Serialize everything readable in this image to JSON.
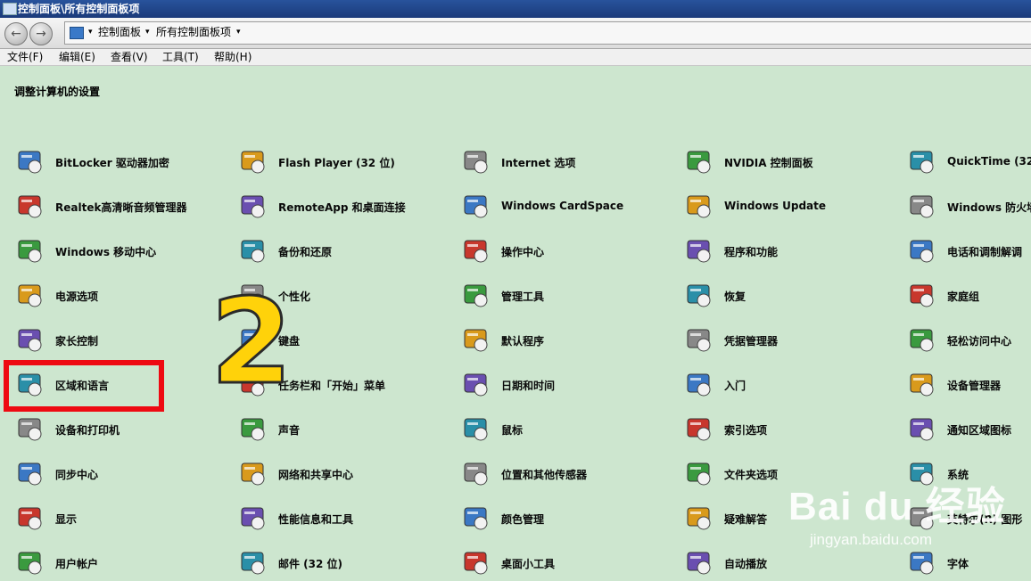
{
  "window": {
    "title": "控制面板\\所有控制面板项"
  },
  "address": {
    "crumbs": [
      "控制面板",
      "所有控制面板项"
    ]
  },
  "menu": [
    "文件(F)",
    "编辑(E)",
    "查看(V)",
    "工具(T)",
    "帮助(H)"
  ],
  "heading": "调整计算机的设置",
  "columns": [
    [
      {
        "label": "BitLocker 驱动器加密",
        "icon": "bitlocker-keys-icon"
      },
      {
        "label": "Realtek高清晰音频管理器",
        "icon": "realtek-audio-icon"
      },
      {
        "label": "Windows 移动中心",
        "icon": "mobility-center-icon"
      },
      {
        "label": "电源选项",
        "icon": "power-battery-icon"
      },
      {
        "label": "家长控制",
        "icon": "parental-controls-icon"
      },
      {
        "label": "区域和语言",
        "icon": "globe-clock-icon"
      },
      {
        "label": "设备和打印机",
        "icon": "printer-icon"
      },
      {
        "label": "同步中心",
        "icon": "sync-arrows-icon"
      },
      {
        "label": "显示",
        "icon": "display-monitor-icon"
      },
      {
        "label": "用户帐户",
        "icon": "user-accounts-icon"
      }
    ],
    [
      {
        "label": "Flash Player (32 位)",
        "icon": "flash-player-icon"
      },
      {
        "label": "RemoteApp 和桌面连接",
        "icon": "remoteapp-icon"
      },
      {
        "label": "备份和还原",
        "icon": "backup-restore-icon"
      },
      {
        "label": "个性化",
        "icon": "personalization-icon"
      },
      {
        "label": "键盘",
        "icon": "keyboard-icon"
      },
      {
        "label": "任务栏和「开始」菜单",
        "icon": "taskbar-icon"
      },
      {
        "label": "声音",
        "icon": "speaker-icon"
      },
      {
        "label": "网络和共享中心",
        "icon": "network-icon"
      },
      {
        "label": "性能信息和工具",
        "icon": "performance-icon"
      },
      {
        "label": "邮件 (32 位)",
        "icon": "mail-icon"
      }
    ],
    [
      {
        "label": "Internet 选项",
        "icon": "internet-options-icon"
      },
      {
        "label": "Windows CardSpace",
        "icon": "cardspace-icon"
      },
      {
        "label": "操作中心",
        "icon": "action-center-flag-icon"
      },
      {
        "label": "管理工具",
        "icon": "admin-tools-icon"
      },
      {
        "label": "默认程序",
        "icon": "default-programs-icon"
      },
      {
        "label": "日期和时间",
        "icon": "calendar-clock-icon"
      },
      {
        "label": "鼠标",
        "icon": "mouse-icon"
      },
      {
        "label": "位置和其他传感器",
        "icon": "location-sensor-icon"
      },
      {
        "label": "颜色管理",
        "icon": "color-management-icon"
      },
      {
        "label": "桌面小工具",
        "icon": "gadgets-icon"
      }
    ],
    [
      {
        "label": "NVIDIA 控制面板",
        "icon": "nvidia-icon"
      },
      {
        "label": "Windows Update",
        "icon": "windows-update-icon"
      },
      {
        "label": "程序和功能",
        "icon": "programs-features-icon"
      },
      {
        "label": "恢复",
        "icon": "recovery-icon"
      },
      {
        "label": "凭据管理器",
        "icon": "credential-safe-icon"
      },
      {
        "label": "入门",
        "icon": "getting-started-icon"
      },
      {
        "label": "索引选项",
        "icon": "indexing-magnifier-icon"
      },
      {
        "label": "文件夹选项",
        "icon": "folder-options-icon"
      },
      {
        "label": "疑难解答",
        "icon": "troubleshooting-icon"
      },
      {
        "label": "自动播放",
        "icon": "autoplay-icon"
      }
    ],
    [
      {
        "label": "QuickTime (32",
        "icon": "quicktime-icon"
      },
      {
        "label": "Windows 防火墙",
        "icon": "firewall-icon"
      },
      {
        "label": "电话和调制解调",
        "icon": "phone-modem-icon"
      },
      {
        "label": "家庭组",
        "icon": "homegroup-icon"
      },
      {
        "label": "轻松访问中心",
        "icon": "ease-of-access-icon"
      },
      {
        "label": "设备管理器",
        "icon": "device-manager-icon"
      },
      {
        "label": "通知区域图标",
        "icon": "notification-area-icon"
      },
      {
        "label": "系统",
        "icon": "system-icon"
      },
      {
        "label": "英特尔(R) 图形",
        "icon": "intel-graphics-icon"
      },
      {
        "label": "字体",
        "icon": "fonts-icon"
      }
    ]
  ],
  "annotation": {
    "number": "2",
    "highlight_color": "#ee0a12",
    "number_color": "#ffd20a"
  },
  "watermark": {
    "logo": "Bai du 经验",
    "url": "jingyan.baidu.com"
  },
  "colors": {
    "background": "#cde6cf",
    "titlebar": "#1b3a7a"
  }
}
